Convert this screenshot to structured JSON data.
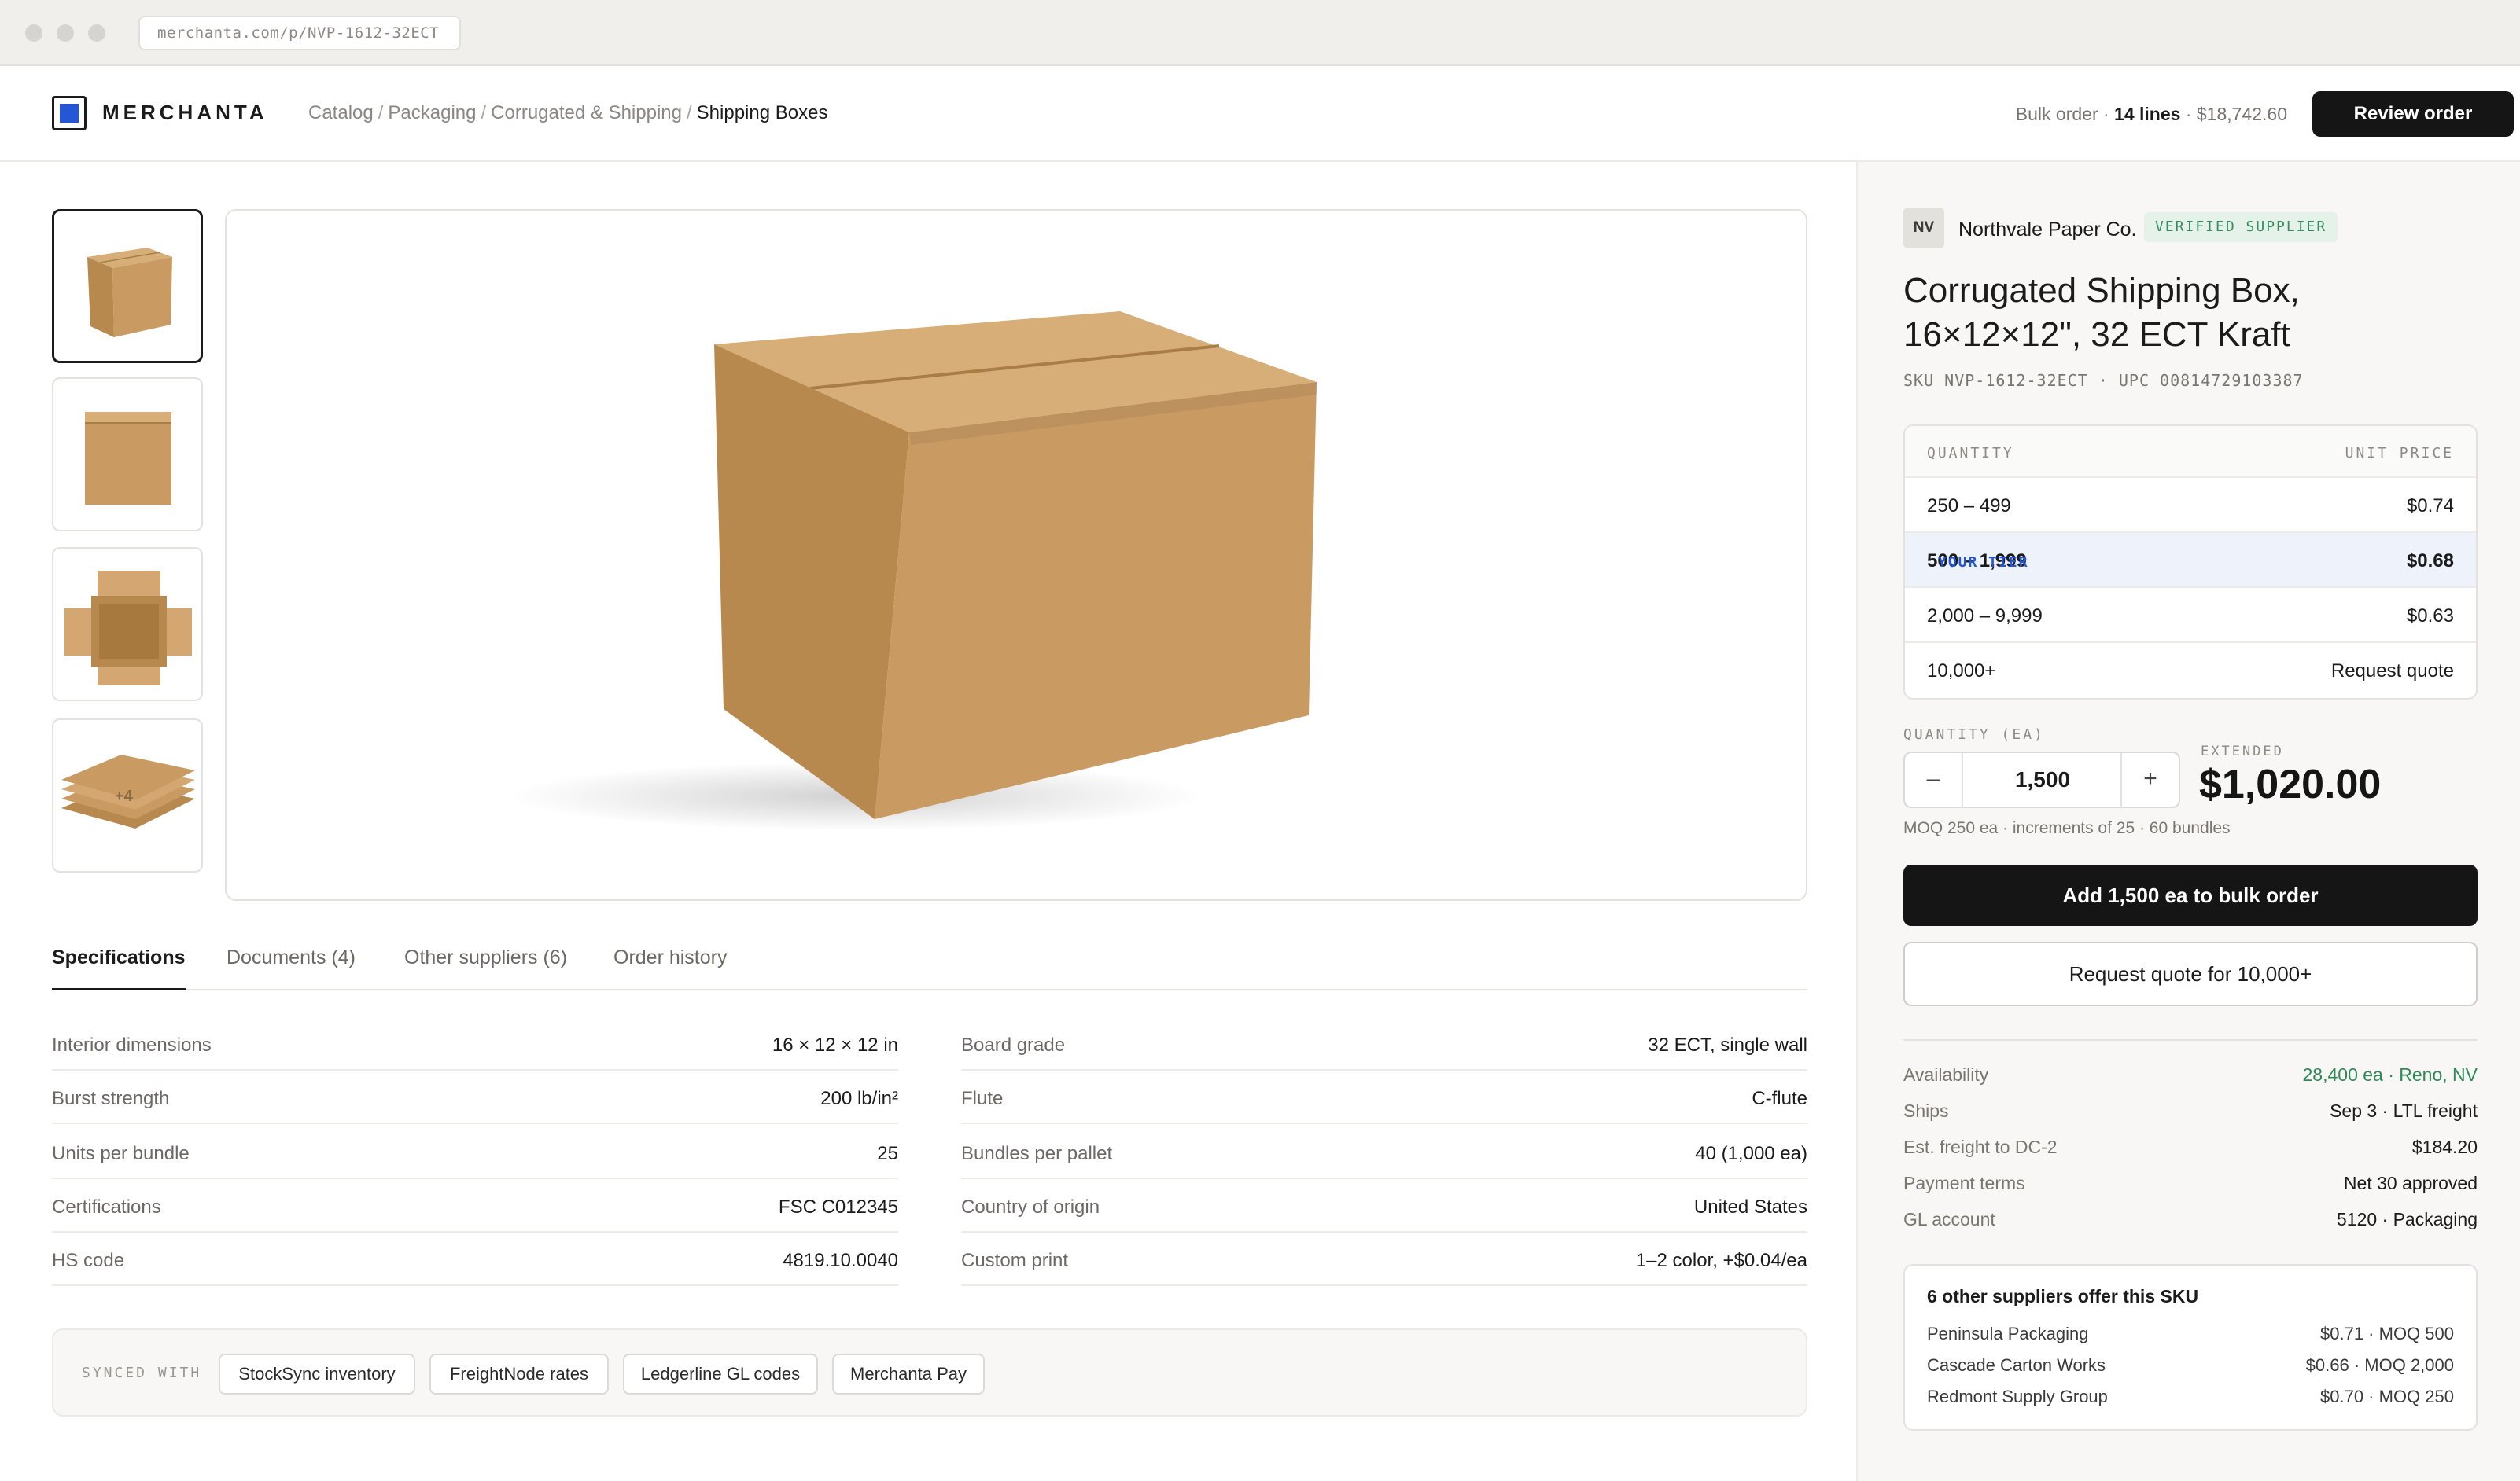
{
  "browser": {
    "url": "merchanta.com/p/NVP-1612-32ECT"
  },
  "header": {
    "brand": "MERCHANTA",
    "breadcrumbs": [
      "Catalog",
      "Packaging",
      "Corrugated & Shipping",
      "Shipping Boxes"
    ],
    "bulk_prefix": "Bulk order ·",
    "bulk_lines": "14 lines",
    "bulk_total": "· $18,742.60",
    "review_label": "Review order"
  },
  "gallery": {
    "more_badge": "+4"
  },
  "tabs": [
    {
      "label": "Specifications"
    },
    {
      "label": "Documents (4)"
    },
    {
      "label": "Other suppliers (6)"
    },
    {
      "label": "Order history"
    }
  ],
  "specs_left": [
    {
      "key": "Interior dimensions",
      "value": "16 × 12 × 12 in"
    },
    {
      "key": "Burst strength",
      "value": "200 lb/in²"
    },
    {
      "key": "Units per bundle",
      "value": "25"
    },
    {
      "key": "Certifications",
      "value": "FSC C012345"
    },
    {
      "key": "HS code",
      "value": "4819.10.0040"
    }
  ],
  "specs_right": [
    {
      "key": "Board grade",
      "value": "32 ECT, single wall"
    },
    {
      "key": "Flute",
      "value": "C-flute"
    },
    {
      "key": "Bundles per pallet",
      "value": "40 (1,000 ea)"
    },
    {
      "key": "Country of origin",
      "value": "United States"
    },
    {
      "key": "Custom print",
      "value": "1–2 color, +$0.04/ea"
    }
  ],
  "synced": {
    "label": "SYNCED WITH",
    "chips": [
      "StockSync inventory",
      "FreightNode rates",
      "Ledgerline GL codes",
      "Merchanta Pay"
    ]
  },
  "product": {
    "supplier_initials": "NV",
    "supplier_name": "Northvale Paper Co.",
    "verified_label": "VERIFIED SUPPLIER",
    "title_line1": "Corrugated Shipping Box,",
    "title_line2": "16×12×12\", 32 ECT Kraft",
    "sku_line": "SKU NVP-1612-32ECT · UPC 00814729103387"
  },
  "pricing": {
    "header_qty": "QUANTITY",
    "header_price": "UNIT PRICE",
    "your_tier_label": "YOUR TIER",
    "tiers": [
      {
        "qty": "250 – 499",
        "price": "$0.74"
      },
      {
        "qty": "500 – 1,999",
        "price": "$0.68"
      },
      {
        "qty": "2,000 – 9,999",
        "price": "$0.63"
      },
      {
        "qty": "10,000+",
        "price": "Request quote"
      }
    ]
  },
  "order": {
    "qty_label": "QUANTITY (EA)",
    "minus": "–",
    "plus": "+",
    "qty_value": "1,500",
    "extended_label": "EXTENDED",
    "extended_value": "$1,020.00",
    "moq_note": "MOQ 250 ea · increments of 25 · 60 bundles",
    "add_label": "Add 1,500 ea to bulk order",
    "quote_label": "Request quote for 10,000+"
  },
  "info": [
    {
      "key": "Availability",
      "value": "28,400 ea · Reno, NV"
    },
    {
      "key": "Ships",
      "value": "Sep 3 · LTL freight"
    },
    {
      "key": "Est. freight to DC-2",
      "value": "$184.20"
    },
    {
      "key": "Payment terms",
      "value": "Net 30 approved"
    },
    {
      "key": "GL account",
      "value": "5120 · Packaging"
    }
  ],
  "other_suppliers": {
    "title": "6 other suppliers offer this SKU",
    "rows": [
      {
        "name": "Peninsula Packaging",
        "offer": "$0.71 · MOQ 500"
      },
      {
        "name": "Cascade Carton Works",
        "offer": "$0.66 · MOQ 2,000"
      },
      {
        "name": "Redmont Supply Group",
        "offer": "$0.70 · MOQ 250"
      }
    ]
  },
  "colors": {
    "accent": "#2457d6",
    "kraft": "#c99b63",
    "availability_green": "#2e8a56"
  }
}
